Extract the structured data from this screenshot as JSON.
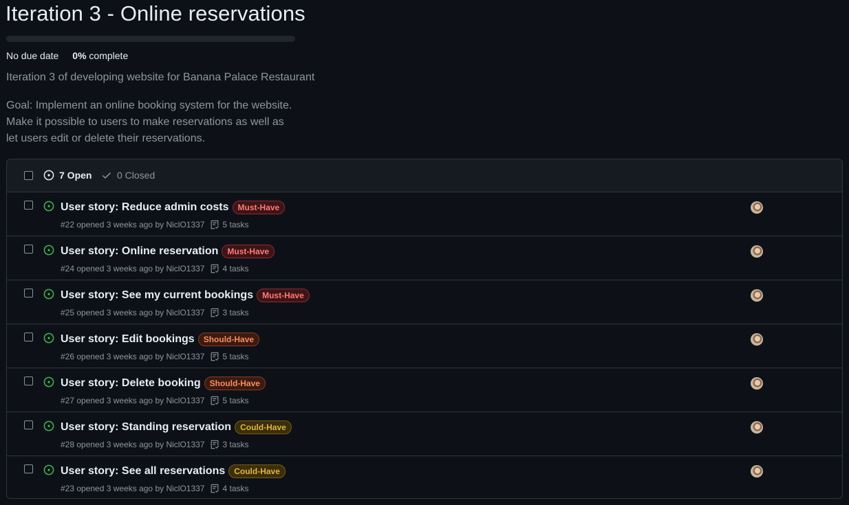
{
  "milestone": {
    "title": "Iteration 3 - Online reservations",
    "due": "No due date",
    "percent_label": "0%",
    "complete_label": "complete",
    "progress": 0,
    "description": "Iteration 3 of developing website for Banana Palace Restaurant",
    "goal_lines": [
      "Goal: Implement an online booking system for the website.",
      "Make it possible to users to make reservations as well as",
      "let users edit or delete their reservations."
    ]
  },
  "filters": {
    "open_label": "7 Open",
    "closed_label": "0 Closed"
  },
  "issues": [
    {
      "title": "User story: Reduce admin costs",
      "label": "Must-Have",
      "label_type": "must",
      "meta": "#22 opened 3 weeks ago by NiclO1337",
      "tasks": "5 tasks",
      "avatar_icon": "user-avatar"
    },
    {
      "title": "User story: Online reservation",
      "label": "Must-Have",
      "label_type": "must",
      "meta": "#24 opened 3 weeks ago by NiclO1337",
      "tasks": "4 tasks",
      "avatar_icon": "user-avatar"
    },
    {
      "title": "User story: See my current bookings",
      "label": "Must-Have",
      "label_type": "must",
      "meta": "#25 opened 3 weeks ago by NiclO1337",
      "tasks": "3 tasks",
      "avatar_icon": "user-avatar"
    },
    {
      "title": "User story: Edit bookings",
      "label": "Should-Have",
      "label_type": "should",
      "meta": "#26 opened 3 weeks ago by NiclO1337",
      "tasks": "5 tasks",
      "avatar_icon": "user-avatar"
    },
    {
      "title": "User story: Delete booking",
      "label": "Should-Have",
      "label_type": "should",
      "meta": "#27 opened 3 weeks ago by NiclO1337",
      "tasks": "5 tasks",
      "avatar_icon": "user-avatar"
    },
    {
      "title": "User story: Standing reservation",
      "label": "Could-Have",
      "label_type": "could",
      "meta": "#28 opened 3 weeks ago by NiclO1337",
      "tasks": "3 tasks",
      "avatar_icon": "user-avatar"
    },
    {
      "title": "User story: See all reservations",
      "label": "Could-Have",
      "label_type": "could",
      "meta": "#23 opened 3 weeks ago by NiclO1337",
      "tasks": "4 tasks",
      "avatar_icon": "user-avatar"
    }
  ],
  "colors": {
    "open_icon": "#3fb950",
    "background": "#0d1117"
  }
}
